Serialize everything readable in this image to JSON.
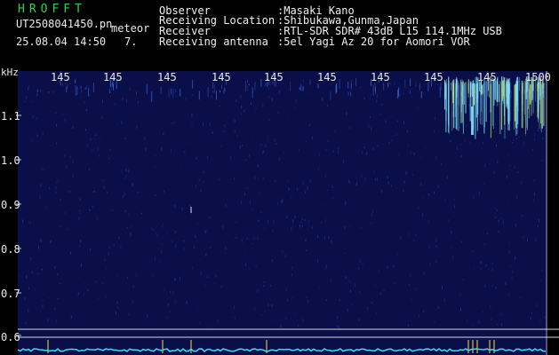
{
  "app": {
    "title": "HROFFT",
    "filename": "UT2508041450.pn",
    "mode": "meteor",
    "datetime": "25.08.04 14:50",
    "count": "7."
  },
  "info": {
    "rows": [
      {
        "label": "Observer",
        "value": ":Masaki Kano"
      },
      {
        "label": "Receiving Location",
        "value": ":Shibukawa,Gunma,Japan"
      },
      {
        "label": "Receiver",
        "value": ":RTL-SDR SDR# 43dB L15 114.1MHz USB"
      },
      {
        "label": "Receiving antenna",
        "value": ":5el Yagi Az 20 for Aomori VOR"
      }
    ]
  },
  "colors": {
    "background": "#000000",
    "plot_bg": "#0a0f4a",
    "noise": "#1f3fb0",
    "echo": "#7fe0ff",
    "baseline": "#30e0ff",
    "reference_line": "#d8d8d8",
    "marker": "#ffe23a",
    "text": "#e9e9e9",
    "title": "#2fd24a"
  },
  "chart_data": {
    "type": "heatmap",
    "x_ticks": [
      "145",
      "145",
      "145",
      "145",
      "145",
      "145",
      "145",
      "145",
      "145",
      "1500"
    ],
    "y_unit": "kHz",
    "y_ticks": [
      "1.1",
      "1.0",
      "0.9",
      "0.8",
      "0.7",
      "0.6"
    ]
  }
}
